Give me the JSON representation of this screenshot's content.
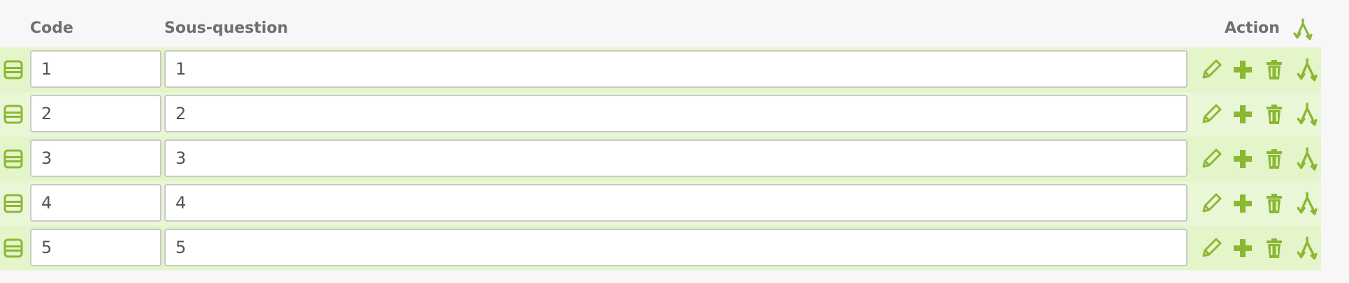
{
  "header": {
    "code_label": "Code",
    "subquestion_label": "Sous-question",
    "action_label": "Action",
    "header_icon": "split-icon"
  },
  "rows": [
    {
      "code": "1",
      "subquestion": "1"
    },
    {
      "code": "2",
      "subquestion": "2"
    },
    {
      "code": "3",
      "subquestion": "3"
    },
    {
      "code": "4",
      "subquestion": "4"
    },
    {
      "code": "5",
      "subquestion": "5"
    }
  ],
  "icons": {
    "drag": "drag-handle-icon",
    "edit": "pencil-icon",
    "add": "plus-icon",
    "delete": "trash-icon",
    "split": "split-icon"
  },
  "colors": {
    "accent": "#8ab833",
    "row_bg": "#eaf7d6",
    "header_text": "#6f6f6f"
  }
}
